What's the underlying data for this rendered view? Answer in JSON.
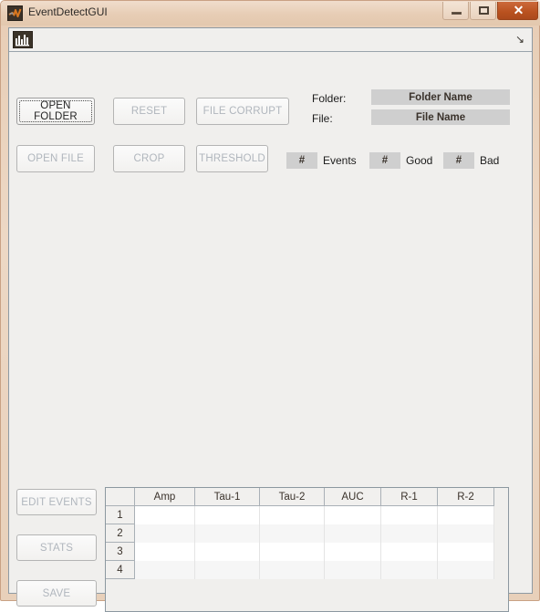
{
  "window": {
    "title": "EventDetectGUI",
    "icon": "matlab-membrane-icon",
    "controls": {
      "minimize": "minimize-icon",
      "maximize": "maximize-icon",
      "close": "✕"
    }
  },
  "toolbar": {
    "plot_icon": "histogram-icon",
    "dock_arrow": "↘"
  },
  "top_buttons": [
    {
      "label": "OPEN FOLDER",
      "enabled": true,
      "focused": true
    },
    {
      "label": "RESET",
      "enabled": false,
      "focused": false
    },
    {
      "label": "FILE CORRUPT",
      "enabled": false,
      "focused": false
    },
    {
      "label": "OPEN FILE",
      "enabled": false,
      "focused": false
    },
    {
      "label": "CROP",
      "enabled": false,
      "focused": false
    },
    {
      "label": "THRESHOLD",
      "enabled": false,
      "focused": false
    }
  ],
  "file_info": {
    "folder_label": "Folder:",
    "folder_value": "Folder Name",
    "file_label": "File:",
    "file_value": "File Name"
  },
  "counters": [
    {
      "value": "#",
      "label": "Events"
    },
    {
      "value": "#",
      "label": "Good"
    },
    {
      "value": "#",
      "label": "Bad"
    }
  ],
  "bottom_buttons": [
    {
      "label": "EDIT EVENTS",
      "enabled": false
    },
    {
      "label": "STATS",
      "enabled": false
    },
    {
      "label": "SAVE",
      "enabled": false
    }
  ],
  "table": {
    "columns": [
      "Amp",
      "Tau-1",
      "Tau-2",
      "AUC",
      "R-1",
      "R-2"
    ],
    "rows": [
      {
        "num": "1",
        "cells": [
          "",
          "",
          "",
          "",
          "",
          ""
        ]
      },
      {
        "num": "2",
        "cells": [
          "",
          "",
          "",
          "",
          "",
          ""
        ]
      },
      {
        "num": "3",
        "cells": [
          "",
          "",
          "",
          "",
          "",
          ""
        ]
      },
      {
        "num": "4",
        "cells": [
          "",
          "",
          "",
          "",
          "",
          ""
        ]
      }
    ]
  },
  "colors": {
    "frame": "#e7cdb5",
    "close_button": "#b9511f",
    "client_background": "#f0efed",
    "field_gray": "#cfcfcf",
    "disabled_text": "#b0b6bd",
    "enabled_text": "#242424"
  }
}
